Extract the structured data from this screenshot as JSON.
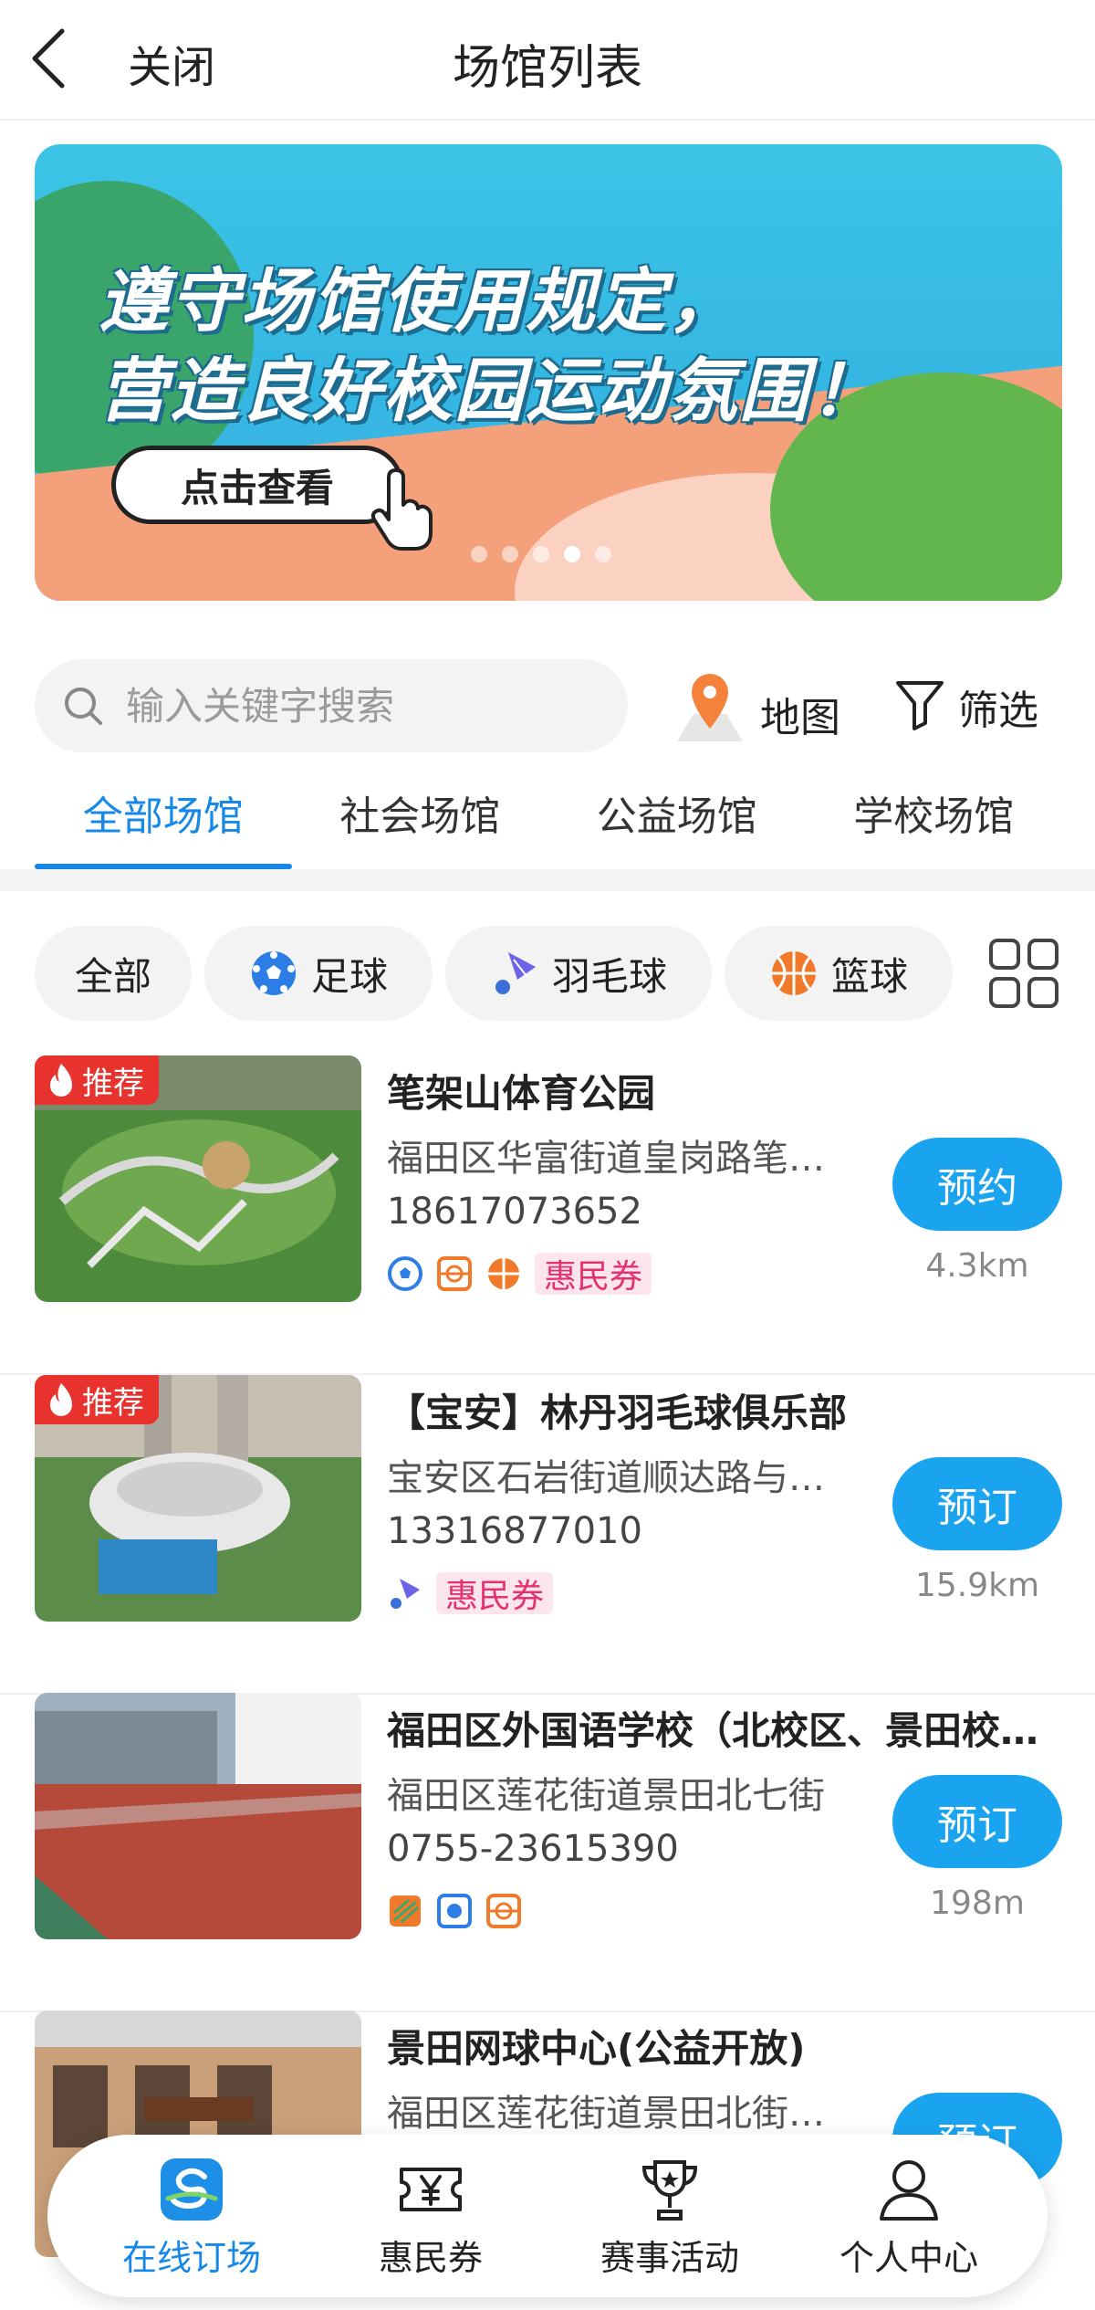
{
  "header": {
    "close_label": "关闭",
    "title": "场馆列表"
  },
  "banner": {
    "line1": "遵守场馆使用规定，",
    "line2": "营造良好校园运动氛围！",
    "button_label": "点击查看",
    "slide_count": 5,
    "active_slide": 4
  },
  "search": {
    "placeholder": "输入关键字搜索",
    "value": ""
  },
  "toolbar": {
    "map_label": "地图",
    "filter_label": "筛选"
  },
  "tabs": [
    {
      "label": "全部场馆",
      "active": true
    },
    {
      "label": "社会场馆",
      "active": false
    },
    {
      "label": "公益场馆",
      "active": false
    },
    {
      "label": "学校场馆",
      "active": false
    }
  ],
  "chips": [
    {
      "label": "全部",
      "icon": ""
    },
    {
      "label": "足球",
      "icon": "football-icon"
    },
    {
      "label": "羽毛球",
      "icon": "badminton-icon"
    },
    {
      "label": "篮球",
      "icon": "basketball-icon"
    }
  ],
  "venues": [
    {
      "badge": "推荐",
      "name": "笔架山体育公园",
      "address": "福田区华富街道皇岗路笔架山公园",
      "phone": "18617073652",
      "tags": [
        "football-icon",
        "basketball-court-icon",
        "basketball-icon"
      ],
      "coupon": "惠民券",
      "action": "预约",
      "distance": "4.3km"
    },
    {
      "badge": "推荐",
      "name": "【宝安】林丹羽毛球俱乐部",
      "address": "宝安区石岩街道顺达路与宝石路交汇处",
      "phone": "13316877010",
      "tags": [
        "badminton-icon"
      ],
      "coupon": "惠民券",
      "action": "预订",
      "distance": "15.9km"
    },
    {
      "badge": "",
      "name": "福田区外国语学校（北校区、景田校区）",
      "address": "福田区莲花街道景田北七街",
      "phone": "0755-23615390",
      "tags": [
        "running-track-icon",
        "football-icon",
        "basketball-court-icon"
      ],
      "coupon": "",
      "action": "预订",
      "distance": "198m"
    },
    {
      "badge": "",
      "name": "景田网球中心(公益开放)",
      "address": "福田区莲花街道景田北街景田网球中心",
      "phone": "",
      "tags": [],
      "coupon": "",
      "action": "预订",
      "distance": ""
    }
  ],
  "bottom_nav": [
    {
      "label": "在线订场",
      "icon": "booking-app-icon",
      "active": true
    },
    {
      "label": "惠民券",
      "icon": "yen-coupon-icon",
      "active": false
    },
    {
      "label": "赛事活动",
      "icon": "trophy-icon",
      "active": false
    },
    {
      "label": "个人中心",
      "icon": "user-icon",
      "active": false
    }
  ],
  "colors": {
    "accent": "#1688e8",
    "button": "#1aa4f0",
    "badge": "#e8322d",
    "coupon_text": "#e5316c",
    "coupon_bg": "#fde5ee"
  }
}
